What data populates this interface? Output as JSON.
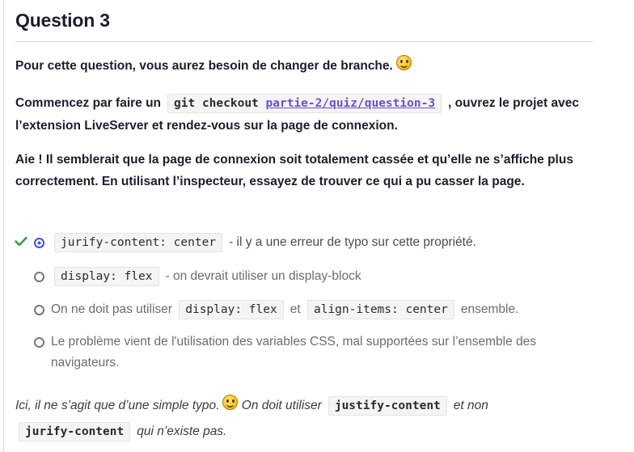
{
  "question": {
    "title": "Question 3",
    "para1": "Pour cette question, vous aurez besoin de changer de branche.",
    "para2_prefix": "Commencez par faire un",
    "para2_cmd": "git checkout",
    "para2_branch": "partie-2/quiz/question-3",
    "para2_suffix": ", ouvrez le projet avec l’extension LiveServer et rendez-vous sur la page de connexion.",
    "para3": "Aie ! Il semblerait que la page de connexion soit totalement cassée et qu’elle ne s’affiche plus correctement. En utilisant l’inspecteur, essayez de trouver ce qui a pu casser la page."
  },
  "options": [
    {
      "code": "jurify-content: center",
      "text": "- il y a une erreur de typo sur cette propriété.",
      "selected": true,
      "correct": true
    },
    {
      "code": "display: flex",
      "text": "- on devrait utiliser un display-block",
      "selected": false
    },
    {
      "prefix": "On ne doit pas utiliser",
      "code": "display: flex",
      "middle": "et",
      "code2": "align-items: center",
      "text": "ensemble.",
      "selected": false
    },
    {
      "text": "Le problème vient de l'utilisation des variables CSS, mal supportées sur l’ensemble des navigateurs.",
      "selected": false
    }
  ],
  "explanation": {
    "part1": "Ici, il ne s’agit que d’une simple typo.",
    "part2": "On doit utiliser",
    "code1": "justify-content",
    "part3": "et non",
    "code2": "jurify-content",
    "part4": "qui n’existe pas."
  },
  "colors": {
    "correct": "#2e9a3c",
    "radio_selected": "#3f51e0",
    "link": "#6a4fd6"
  },
  "icons": [
    "smiley-icon",
    "checkmark-icon",
    "radio-icon"
  ]
}
